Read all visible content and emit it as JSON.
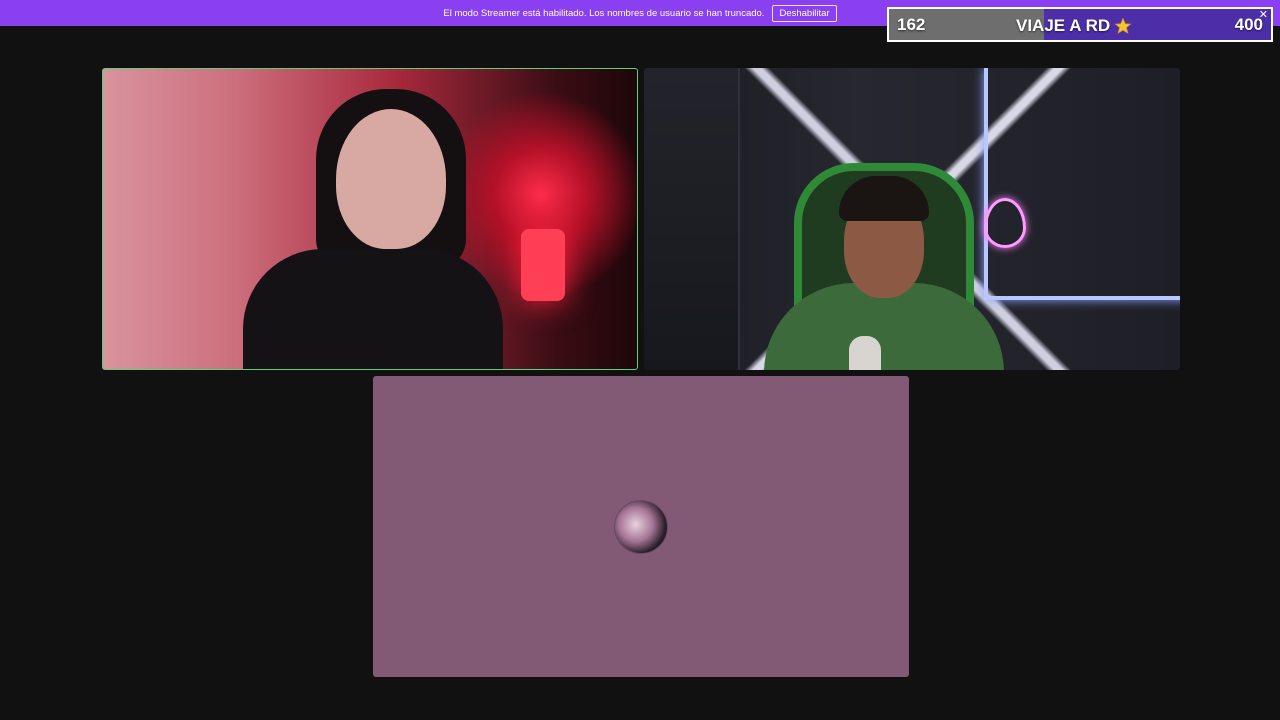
{
  "banner": {
    "text": "El modo Streamer está habilitado. Los nombres de usuario se han truncado.",
    "button_label": "Deshabilitar",
    "color": "#8a3ff0"
  },
  "goal": {
    "current": "162",
    "target": "400",
    "title": "VIAJE A RD",
    "icon": "star-icon",
    "progress_fraction": 0.405,
    "close_icon": "✕",
    "fill_color": "#6e6e6e",
    "remaining_color": "#4c2fa8"
  },
  "call": {
    "participants": [
      {
        "id": "participant-1",
        "active_speaker": true,
        "accent": "#5fd07a"
      },
      {
        "id": "participant-2",
        "active_speaker": false
      },
      {
        "id": "participant-3",
        "camera_off": true,
        "tile_color": "#835a76"
      }
    ]
  }
}
